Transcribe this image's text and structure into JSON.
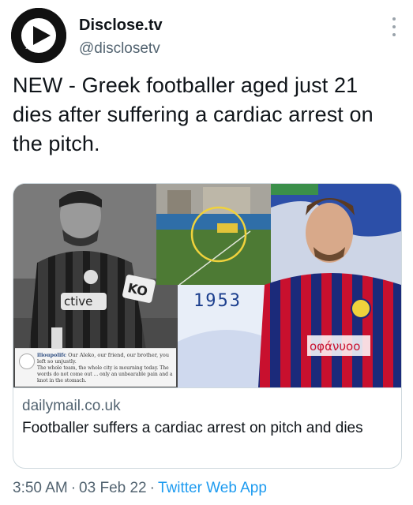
{
  "header": {
    "name": "Disclose.tv",
    "handle": "@disclosetv"
  },
  "tweet": {
    "text": "NEW - Greek footballer aged just 21 dies after suffering a cardiac arrest on the pitch."
  },
  "card": {
    "domain": "dailymail.co.uk",
    "title": "Footballer suffers a cardiac arrest on pitch and dies",
    "image": {
      "jersey_left_text": "ctive",
      "jersey_left_badge": "KO",
      "year_text": "1953",
      "jersey_right_text": "οφάνυοο",
      "caption_user": "ilioupolifc",
      "caption_line1": "Our Aleko, our friend, our brother, you left so unjustly.",
      "caption_line2": "The whole team, the whole city is mourning today. The words do not come out ... only an unbearable pain and a knot in the stomach."
    }
  },
  "meta": {
    "time": "3:50 AM",
    "date": "03 Feb 22",
    "app": "Twitter Web App"
  },
  "colors": {
    "link_blue": "#1d9bf0",
    "secondary_text": "#536471",
    "border": "#cfd9de",
    "jersey_red": "#c8102e",
    "jersey_blue": "#1b2a7a"
  }
}
